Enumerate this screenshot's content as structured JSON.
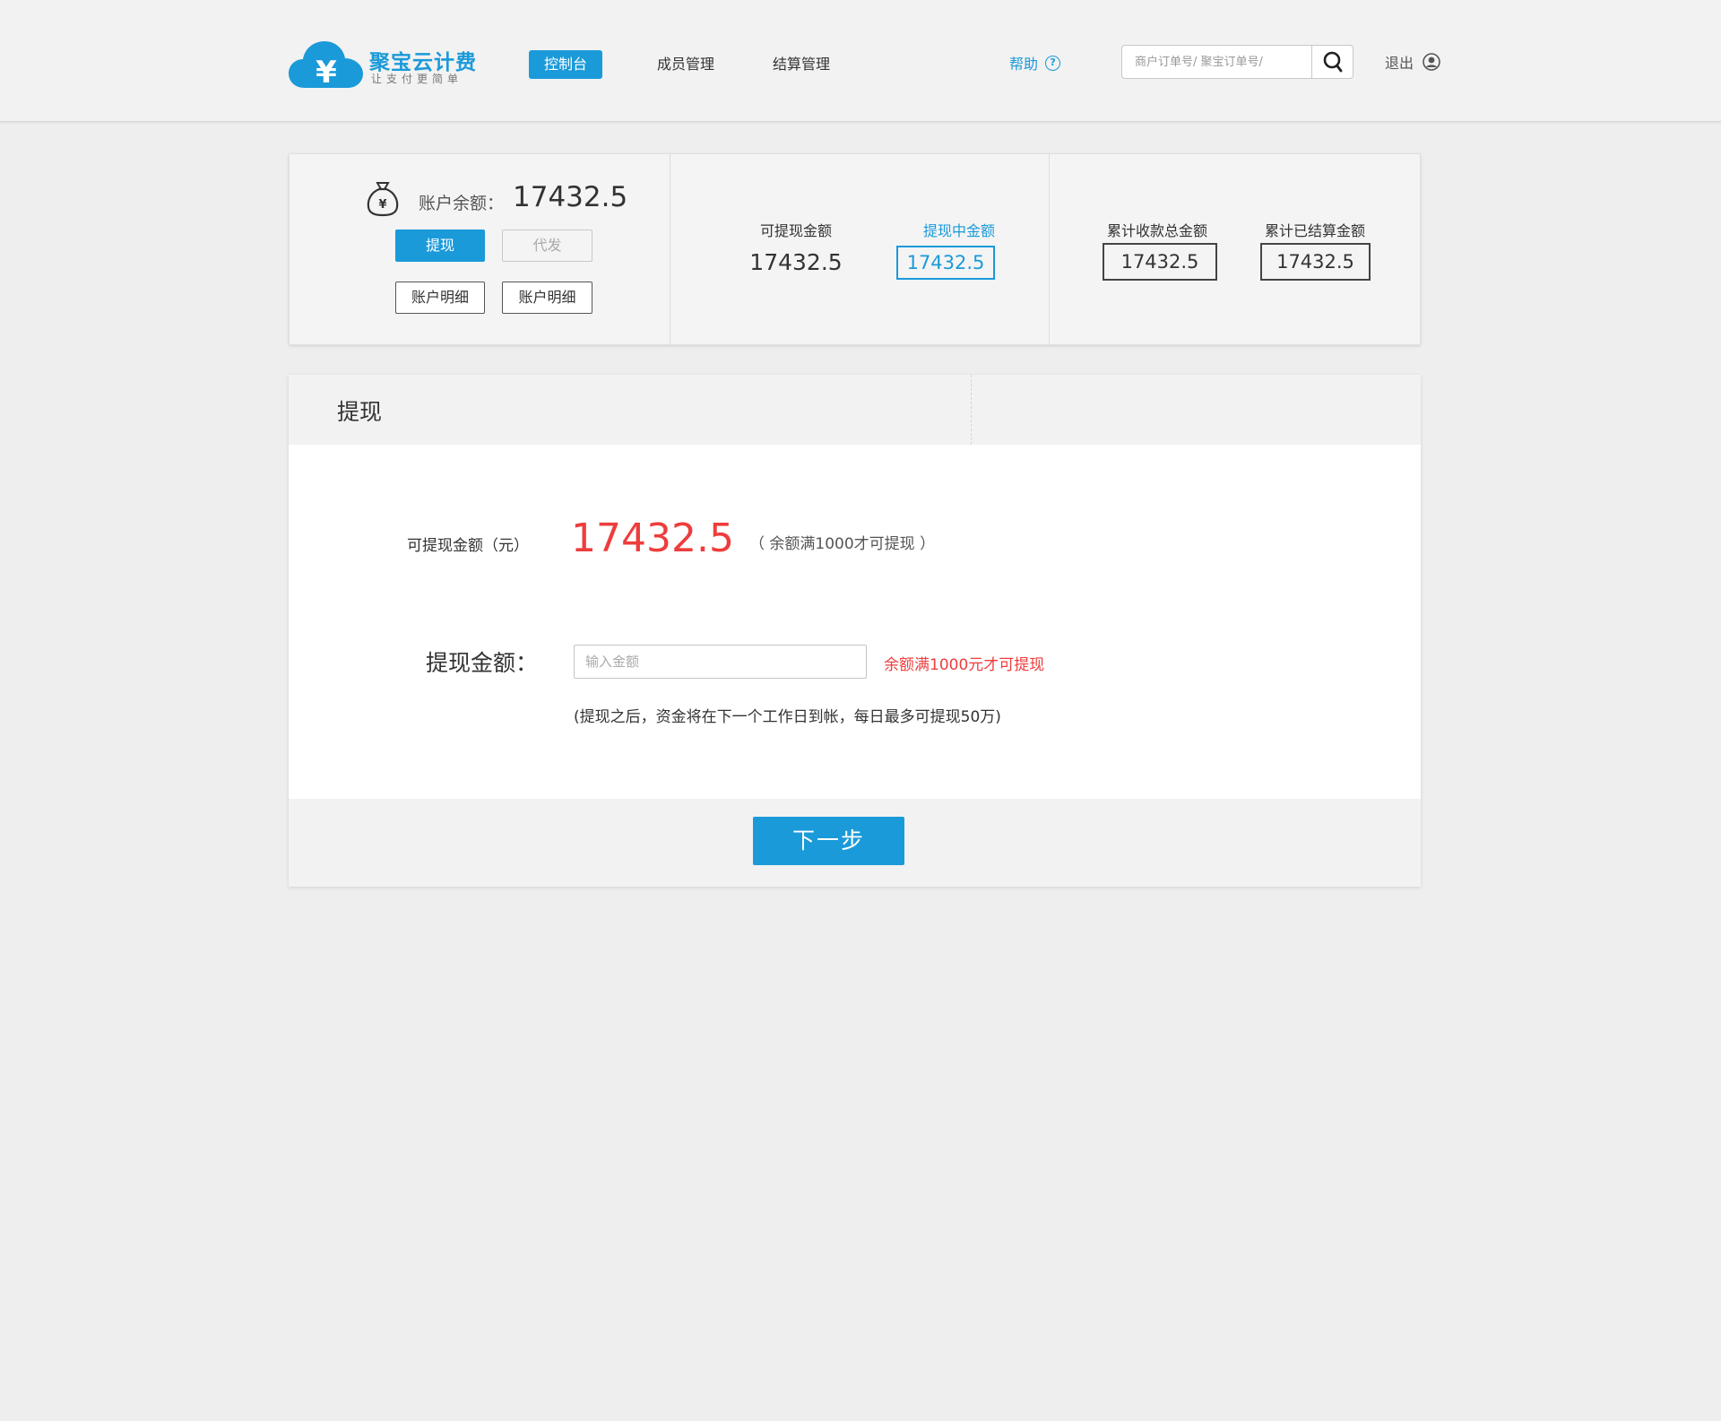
{
  "brand": {
    "name": "聚宝云计费",
    "tagline": "让支付更简单",
    "accent_color": "#1a9ad9",
    "alert_color": "#ee3d3d"
  },
  "nav": {
    "items": [
      {
        "label": "控制台",
        "active": true
      },
      {
        "label": "成员管理",
        "active": false
      },
      {
        "label": "结算管理",
        "active": false
      }
    ]
  },
  "header": {
    "help_label": "帮助",
    "help_icon": "?",
    "search_placeholder": "商户订单号/ 聚宝订单号/",
    "search_icon": "search-icon",
    "logout_label": "退出",
    "logout_icon": "user-circle-icon"
  },
  "summary": {
    "balance_label": "账户余额：",
    "balance_value": "17432.5",
    "buttons": {
      "withdraw": "提现",
      "daifa": "代发",
      "detail_1": "账户明细",
      "detail_2": "账户明细"
    },
    "withdrawable_label": "可提现金额",
    "withdrawable_value": "17432.5",
    "withdrawing_label": "提现中金额",
    "withdrawing_value": "17432.5",
    "total_received_label": "累计收款总金额",
    "total_received_value": "17432.5",
    "total_settled_label": "累计已结算金额",
    "total_settled_value": "17432.5"
  },
  "withdraw_panel": {
    "title": "提现",
    "available_label": "可提现金额（元）",
    "available_value": "17432.5",
    "available_note": "（ 余额满1000才可提现 ）",
    "amount_label": "提现金额：",
    "amount_placeholder": "输入金额",
    "amount_warning": "余额满1000元才可提现",
    "arrival_note": "(提现之后，资金将在下一个工作日到帐，每日最多可提现50万)",
    "next_button": "下一步"
  }
}
